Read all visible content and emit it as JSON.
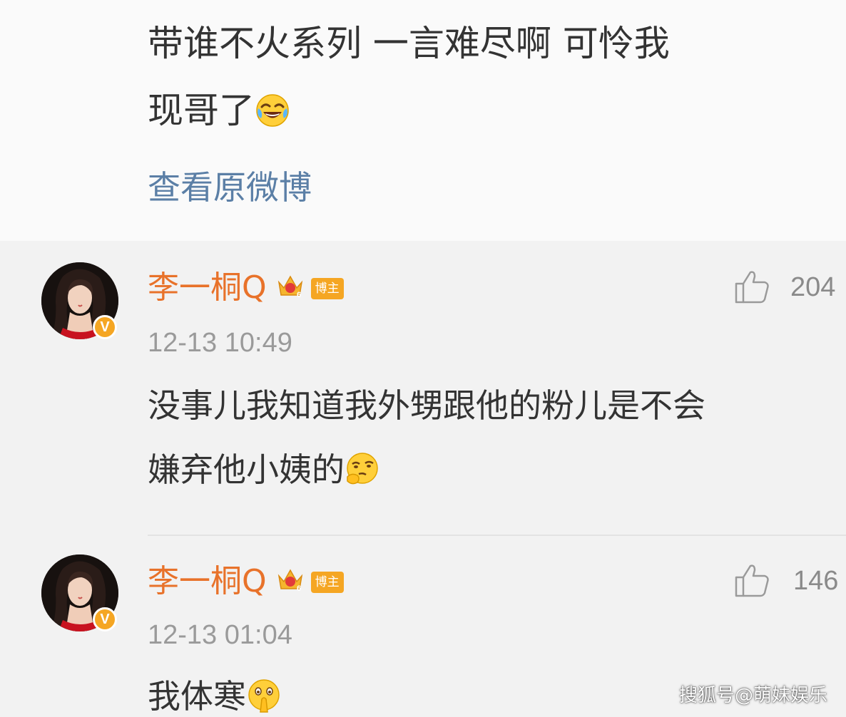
{
  "post": {
    "text_line1": "带谁不火系列   一言难尽啊   可怜我",
    "text_line2": "现哥了",
    "text_line2_emoji": "laughing-crying-emoji",
    "view_original_label": "查看原微博"
  },
  "comments": [
    {
      "username": "李一桐Q",
      "badge_label": "博主",
      "crown_label": "6",
      "verified_label": "V",
      "like_count": "204",
      "timestamp": "12-13 10:49",
      "text_line1": "没事儿我知道我外甥跟他的粉儿是不会",
      "text_line2": "嫌弃他小姨的",
      "emoji": "thinking-emoji"
    },
    {
      "username": "李一桐Q",
      "badge_label": "博主",
      "crown_label": "6",
      "verified_label": "V",
      "like_count": "146",
      "timestamp": "12-13 01:04",
      "text_line1": "我体寒",
      "emoji": "shush-emoji"
    }
  ],
  "watermark": "搜狐号@萌妹娱乐",
  "colors": {
    "username": "#e8722a",
    "link": "#5b7fa6",
    "badge": "#f5a623",
    "meta": "#9a9a9a",
    "text": "#333333"
  }
}
